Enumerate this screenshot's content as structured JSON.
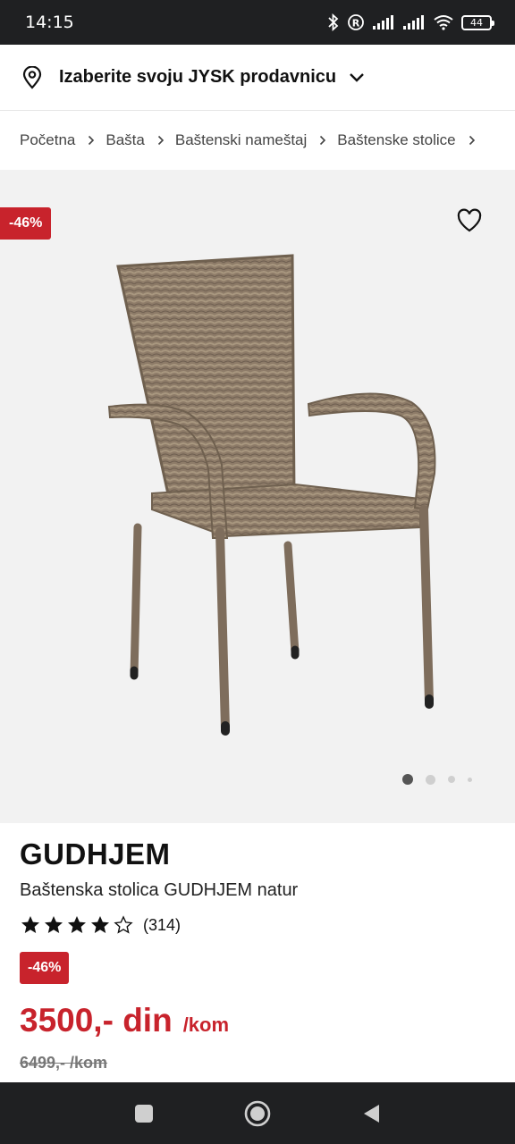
{
  "status_bar": {
    "time": "14:15",
    "battery": "44"
  },
  "store_selector": {
    "label": "Izaberite svoju JYSK prodavnicu"
  },
  "breadcrumb": [
    "Početna",
    "Bašta",
    "Baštenski nameštaj",
    "Baštenske stolice"
  ],
  "gallery": {
    "discount_badge": "-46%",
    "active_image": 1,
    "image_count": 4
  },
  "product": {
    "brand": "GUDHJEM",
    "name": "Baštenska stolica GUDHJEM natur",
    "rating": 4,
    "rating_max": 5,
    "review_count": "(314)",
    "discount_badge": "-46%",
    "price": "3500,- din",
    "price_unit": "/kom",
    "old_price": "6499,- /kom"
  },
  "colors": {
    "accent_red": "#c8232c",
    "system_bar": "#1f2022",
    "gallery_bg": "#f2f2f2"
  }
}
